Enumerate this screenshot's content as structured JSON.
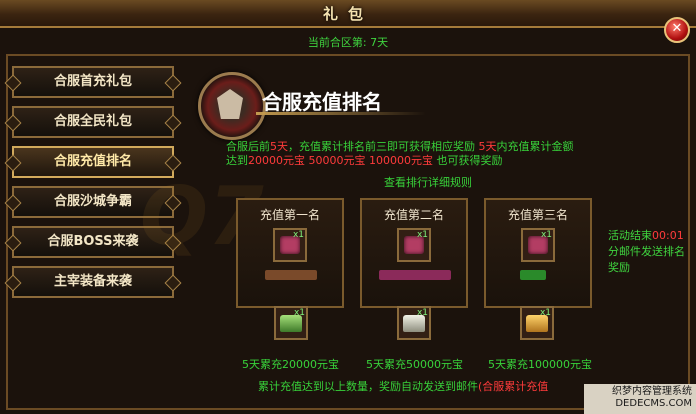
{
  "window": {
    "title": "礼包",
    "zone_text": "当前合区第: 7天"
  },
  "tabs": [
    {
      "label": "合服首充礼包"
    },
    {
      "label": "合服全民礼包"
    },
    {
      "label": "合服充值排名"
    },
    {
      "label": "合服沙城争霸"
    },
    {
      "label": "合服BOSS来袭"
    },
    {
      "label": "主宰装备来袭"
    }
  ],
  "panel": {
    "heading": "合服充值排名",
    "desc_line1": {
      "p1": "合服后前",
      "d1": "5天",
      "p2": "，充值累计排名前三即可获得相应奖励 ",
      "d2": "5天",
      "p3": "内充值累计金额"
    },
    "desc_line2": {
      "p1": "达到",
      "a1": "20000元宝",
      "a2": "50000元宝",
      "a3": "100000元宝",
      "p2": "也可获得奖励"
    },
    "rules_link": "查看排行详细规则",
    "ranks": [
      {
        "title": "充值第一名",
        "item_count": "x1"
      },
      {
        "title": "充值第二名",
        "item_count": "x1"
      },
      {
        "title": "充值第三名",
        "item_count": "x1"
      }
    ],
    "rewards": [
      {
        "label": "5天累充20000元宝",
        "item_count": "x1"
      },
      {
        "label": "5天累充50000元宝",
        "item_count": "x1"
      },
      {
        "label": "5天累充100000元宝",
        "item_count": "x1"
      }
    ],
    "note": {
      "p1": "活动结束",
      "time": "00:01",
      "p2": "分邮件发送排名奖励"
    },
    "bottom_text": {
      "p1": "累计充值达到以上数量，奖励自动发送到邮件",
      "p2": "(合服累计充值"
    }
  },
  "watermark_text": "Q7",
  "corner_text": {
    "line1": "织梦内容管理系统",
    "line2": "DEDECMS.COM"
  },
  "colors": {
    "accent_green": "#38d23a",
    "accent_red": "#ff3b3b",
    "gold_border": "#8b6a3a"
  }
}
